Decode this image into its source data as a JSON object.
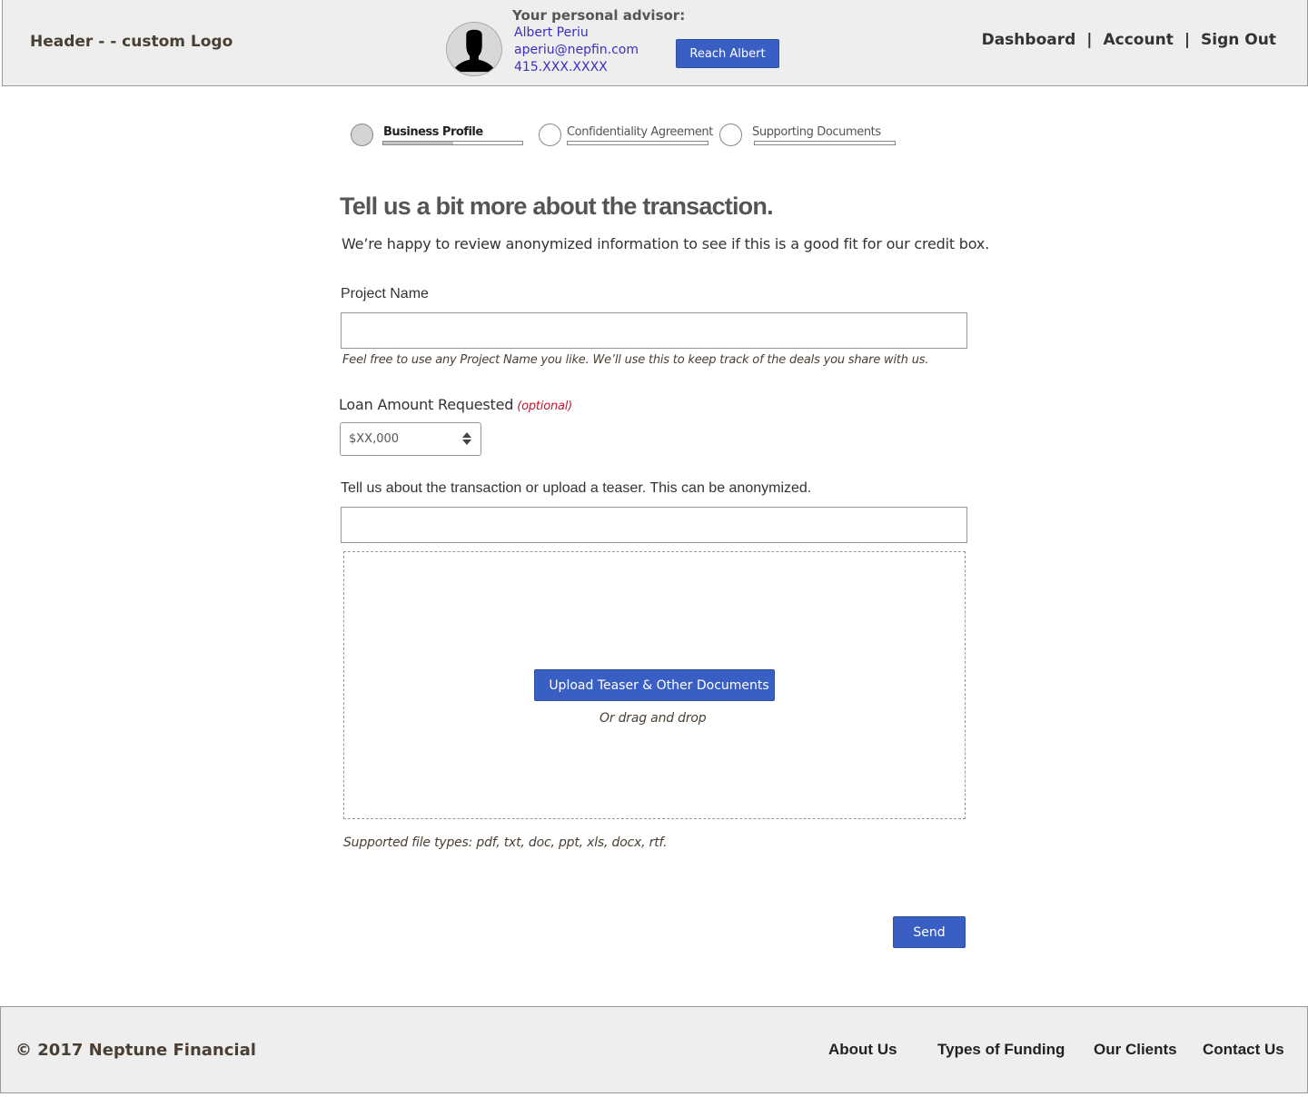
{
  "header": {
    "logo_text": "Header - - custom Logo",
    "advisor": {
      "title": "Your personal advisor:",
      "name": "Albert Periu",
      "email": "aperiu@nepfin.com",
      "phone": "415.XXX.XXXX",
      "avatar_icon": "person-silhouette-icon",
      "contact_button": "Reach Albert"
    },
    "nav": [
      {
        "label": "Dashboard"
      },
      {
        "label": "Account"
      },
      {
        "label": "Sign Out"
      }
    ],
    "nav_separator": "|"
  },
  "stepper": {
    "steps": [
      {
        "label": "Business Profile",
        "active": true,
        "progress": 0.5
      },
      {
        "label": "Confidentiality Agreement",
        "active": false,
        "progress": 0
      },
      {
        "label": "Supporting Documents",
        "active": false,
        "progress": 0
      }
    ]
  },
  "form": {
    "title": "Tell us a bit more about the transaction.",
    "subtitle": "We’re happy to review anonymized information to see if this is a good fit for our credit box.",
    "project_name": {
      "label": "Project Name",
      "value": "",
      "hint": "Feel free to use any Project Name you like. We’ll use this to keep track of the deals you share with us."
    },
    "loan_amount": {
      "label": "Loan Amount Requested",
      "optional_tag": "(optional)",
      "value": "$XX,000"
    },
    "transaction": {
      "label": "Tell us about the transaction or upload a teaser. This can be anonymized.",
      "value": ""
    },
    "upload": {
      "button_label": "Upload Teaser & Other Documents",
      "drag_text": "Or drag and drop",
      "supported_types": "Supported file types: pdf, txt, doc, ppt, xls, docx, rtf."
    },
    "send_label": "Send"
  },
  "footer": {
    "copyright": "© 2017 Neptune Financial",
    "links": [
      {
        "label": "About Us"
      },
      {
        "label": "Types of Funding"
      },
      {
        "label": "Our Clients"
      },
      {
        "label": "Contact Us"
      }
    ]
  },
  "colors": {
    "primary_button": "#3a5fc4",
    "advisor_link": "#3a2fc0",
    "optional_tag": "#c4122f",
    "header_bg": "#eeeeee"
  }
}
